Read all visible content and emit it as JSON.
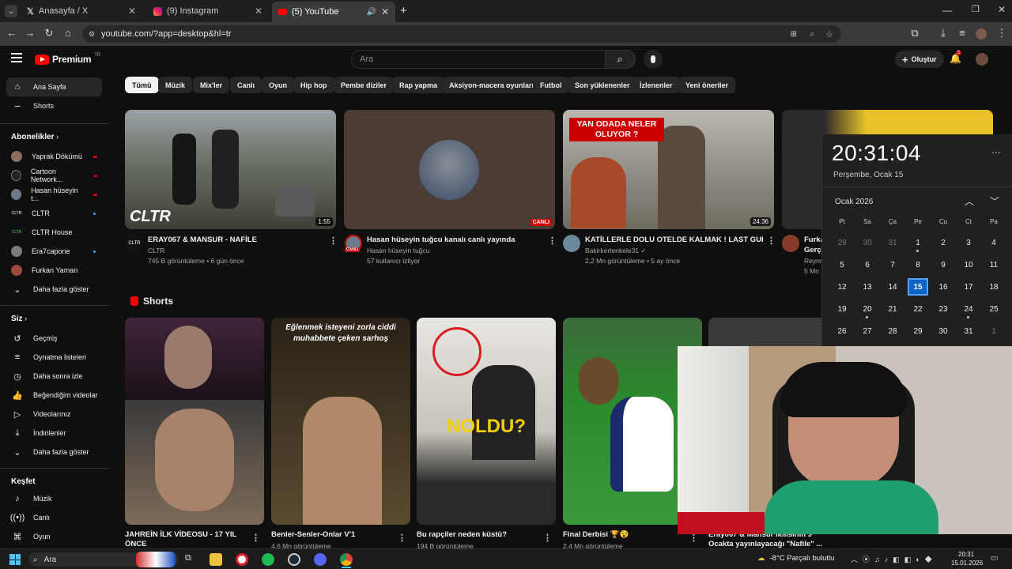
{
  "browser": {
    "tabs": [
      {
        "label": "Anasayfa / X",
        "icon": "x-logo-icon"
      },
      {
        "label": "(9) Instagram",
        "icon": "instagram-icon"
      },
      {
        "label": "(5) YouTube",
        "icon": "youtube-icon"
      }
    ],
    "url": "youtube.com/?app=desktop&hl=tr"
  },
  "header": {
    "logo_text": "Premium",
    "logo_sup": "TR",
    "search_placeholder": "Ara",
    "create_label": "Oluştur",
    "notif_count": "5"
  },
  "sidebar": {
    "main": [
      {
        "label": "Ana Sayfa",
        "icon": "home-icon"
      },
      {
        "label": "Shorts",
        "icon": "shorts-icon"
      }
    ],
    "subs_title": "Abonelikler",
    "subs": [
      {
        "label": "Yaprak Dökümü"
      },
      {
        "label": "Cartoon Network..."
      },
      {
        "label": "Hasan hüseyin t..."
      },
      {
        "label": "CLTR"
      },
      {
        "label": "CLTR House"
      },
      {
        "label": "Era7capone"
      },
      {
        "label": "Furkan Yaman"
      },
      {
        "label": "Daha fazla göster"
      }
    ],
    "you_title": "Siz",
    "you": [
      {
        "label": "Geçmiş",
        "icon": "history-icon"
      },
      {
        "label": "Oynatma listeleri",
        "icon": "playlist-icon"
      },
      {
        "label": "Daha sonra izle",
        "icon": "clock-icon"
      },
      {
        "label": "Beğendiğim videolar",
        "icon": "like-icon"
      },
      {
        "label": "Videolarınız",
        "icon": "video-icon"
      },
      {
        "label": "İndirilenler",
        "icon": "download-icon"
      },
      {
        "label": "Daha fazla göster",
        "icon": "chevron-down-icon"
      }
    ],
    "explore_title": "Keşfet",
    "explore": [
      {
        "label": "Müzik",
        "icon": "music-icon"
      },
      {
        "label": "Canlı",
        "icon": "live-icon"
      },
      {
        "label": "Oyun",
        "icon": "game-icon"
      }
    ]
  },
  "chips": [
    "Tümü",
    "Müzik",
    "Mix'ler",
    "Canlı",
    "Oyun",
    "Hip hop",
    "Pembe diziler",
    "Rap yapma",
    "Aksiyon-macera oyunları",
    "Futbol",
    "Son yüklenenler",
    "İzlenenler",
    "Yeni öneriler"
  ],
  "videos": [
    {
      "title": "ERAY067 & MANSUR - NAFİLE",
      "channel": "CLTR",
      "meta": "745 B görüntüleme • 6 gün önce",
      "badge": "1:55",
      "thumb_text": "CLTR"
    },
    {
      "title": "Hasan hüseyin tuğcu kanalı canlı yayında",
      "channel": "Hasan hüseyin tuğcu",
      "meta": "57 kullanıcı izliyor",
      "badge": "CANLI",
      "avatar_badge": "CANLI"
    },
    {
      "title": "KATİLLERLE DOLU OTELDE KALMAK ! LAST GUEST",
      "channel": "Bakirkertenkele31",
      "meta": "2,2 Mn görüntüleme • 5 ay önce",
      "badge": "24:36",
      "thumb_text": "YAN ODADA NELER OLUYOR ?"
    },
    {
      "title": "Furka",
      "channel": "Gerçe",
      "channel2": "Reynm",
      "meta": "5 Mn"
    }
  ],
  "shorts_title": "Shorts",
  "shorts": [
    {
      "title": "JAHREİN İLK VİDEOSU - 17 YIL ÖNCE",
      "meta": ""
    },
    {
      "title": "Benler-Senler-Onlar V'1",
      "meta": "4,6 Mn görüntüleme",
      "overlay": "Eğlenmek isteyeni zorla ciddi muhabbete çeken sarhoş"
    },
    {
      "title": "Bu rapçiler neden küstü?",
      "meta": "194 B görüntüleme",
      "overlay": "NOLDU?"
    },
    {
      "title": "Final Derbisi 🏆😵",
      "meta": "2,4 Mn görüntüleme"
    },
    {
      "title": "Eray067 & Mansur ikilisinin 9 Ocakta yayınlayacağı \"Nafile\" ..."
    }
  ],
  "calendar": {
    "time": "20:31:04",
    "date_long": "Perşembe, Ocak 15",
    "month_title": "Ocak 2026",
    "weekdays": [
      "Pt",
      "Sa",
      "Ça",
      "Pe",
      "Cu",
      "Ct",
      "Pa"
    ],
    "days": [
      "29",
      "30",
      "31",
      "1",
      "2",
      "3",
      "4",
      "5",
      "6",
      "7",
      "8",
      "9",
      "10",
      "11",
      "12",
      "13",
      "14",
      "15",
      "16",
      "17",
      "18",
      "19",
      "20",
      "21",
      "22",
      "23",
      "24",
      "25",
      "26",
      "27",
      "28",
      "29",
      "30",
      "31",
      "1"
    ],
    "today": "15"
  },
  "taskbar": {
    "search_label": "Ara",
    "weather": "-8°C  Parçalı bulutlu",
    "clock_time": "20:31",
    "clock_date": "15.01.2026"
  },
  "colors": {
    "accent": "#ff0000",
    "bg": "#0f0f0f",
    "calendar_today": "#0a64c8"
  }
}
